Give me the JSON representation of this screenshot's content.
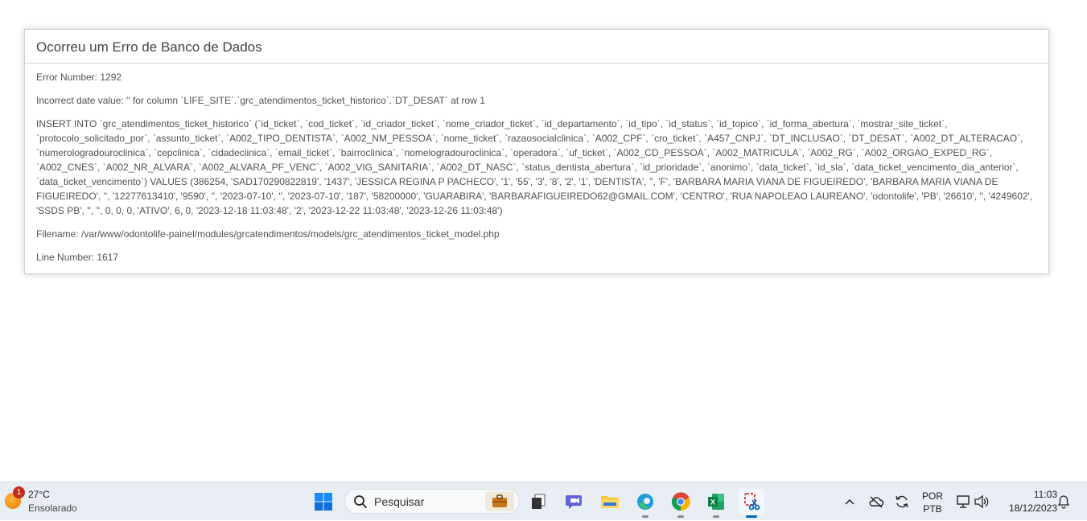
{
  "error": {
    "heading": "Ocorreu um Erro de Banco de Dados",
    "number_line": "Error Number: 1292",
    "message_line": "Incorrect date value: '' for column `LIFE_SITE`.`grc_atendimentos_ticket_historico`.`DT_DESAT` at row 1",
    "sql_line": "INSERT INTO `grc_atendimentos_ticket_historico` (`id_ticket`, `cod_ticket`, `id_criador_ticket`, `nome_criador_ticket`, `id_departamento`, `id_tipo`, `id_status`, `id_topico`, `id_forma_abertura`, `mostrar_site_ticket`, `protocolo_solicitado_por`, `assunto_ticket`, `A002_TIPO_DENTISTA`, `A002_NM_PESSOA`, `nome_ticket`, `razaosocialclinica`, `A002_CPF`, `cro_ticket`, `A457_CNPJ`, `DT_INCLUSAO`, `DT_DESAT`, `A002_DT_ALTERACAO`, `numerologradouroclinica`, `cepclinica`, `cidadeclinica`, `email_ticket`, `bairroclinica`, `nomelogradouroclinica`, `operadora`, `uf_ticket`, `A002_CD_PESSOA`, `A002_MATRICULA`, `A002_RG`, `A002_ORGAO_EXPED_RG`, `A002_CNES`, `A002_NR_ALVARA`, `A002_ALVARA_PF_VENC`, `A002_VIG_SANITARIA`, `A002_DT_NASC`, `status_dentista_abertura`, `id_prioridade`, `anonimo`, `data_ticket`, `id_sla`, `data_ticket_vencimento_dia_anterior`, `data_ticket_vencimento`) VALUES (386254, 'SAD170290822819', '1437', 'JESSICA REGINA P PACHECO', '1', '55', '3', '8', '2', '1', 'DENTISTA', '', 'F', 'BARBARA MARIA VIANA DE FIGUEIREDO', 'BARBARA MARIA VIANA DE FIGUEIREDO', '', '12277613410', '9590', '', '2023-07-10', '', '2023-07-10', '187', '58200000', 'GUARABIRA', 'BARBARAFIGUEIREDO62@GMAIL.COM', 'CENTRO', 'RUA NAPOLEAO LAUREANO', 'odontolife', 'PB', '26610', '', '4249602', 'SSDS PB', '', '', 0, 0, 0, 'ATIVO', 6, 0, '2023-12-18 11:03:48', '2', '2023-12-22 11:03:48', '2023-12-26 11:03:48')",
    "filename_line": "Filename: /var/www/odontolife-painel/modules/grcatendimentos/models/grc_atendimentos_ticket_model.php",
    "line_number_line": "Line Number: 1617"
  },
  "taskbar": {
    "weather": {
      "badge": "1",
      "temperature": "27°C",
      "condition": "Ensolarado",
      "icon": "sun-icon"
    },
    "search": {
      "placeholder": "Pesquisar",
      "icon": "search-icon"
    },
    "apps": [
      {
        "name": "start-button",
        "icon": "windows-logo-icon"
      },
      {
        "name": "task-view",
        "icon": "task-view-icon"
      },
      {
        "name": "teams",
        "icon": "chat-icon"
      },
      {
        "name": "file-explorer",
        "icon": "folder-icon"
      },
      {
        "name": "edge",
        "icon": "edge-icon"
      },
      {
        "name": "chrome",
        "icon": "chrome-icon"
      },
      {
        "name": "excel",
        "icon": "excel-icon"
      },
      {
        "name": "snipping-tool",
        "icon": "snipping-tool-icon"
      }
    ],
    "tray": {
      "language_top": "POR",
      "language_bottom": "PTB",
      "time": "11:03",
      "date": "18/12/2023"
    }
  },
  "colors": {
    "taskbar_bg": "#e9eef5",
    "accent": "#0067c0",
    "border": "#d0d0d0"
  }
}
